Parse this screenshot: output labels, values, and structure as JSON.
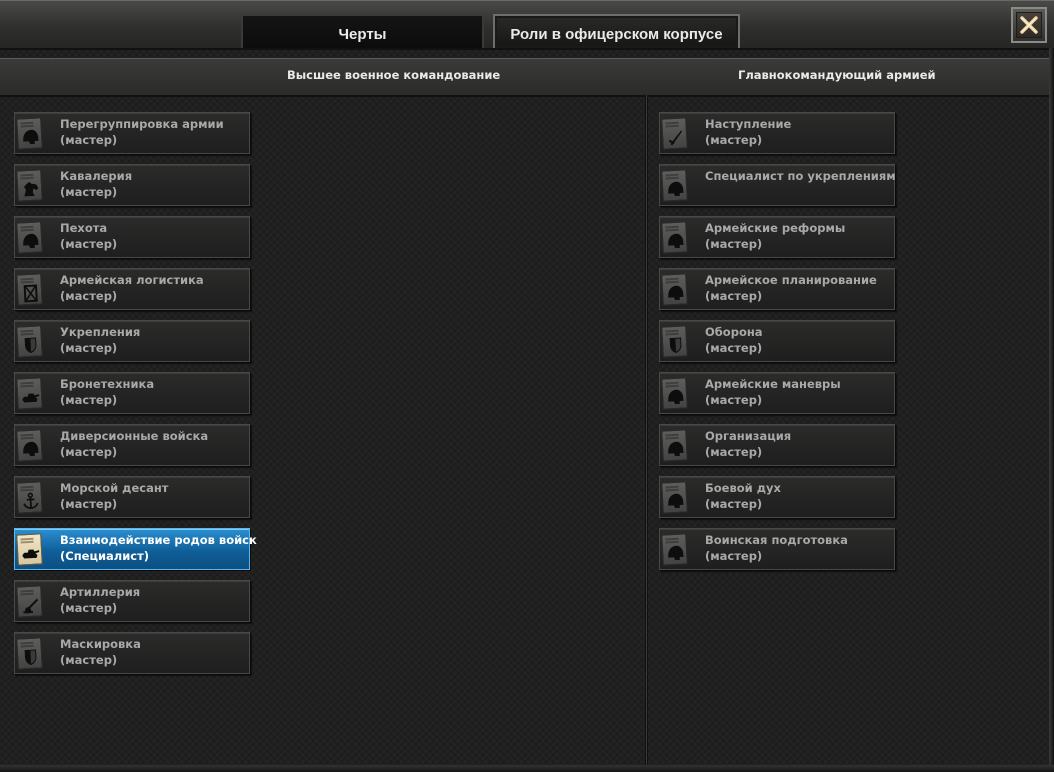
{
  "tabs": {
    "traits": "Черты",
    "roles": "Роли в офицерском корпусе"
  },
  "columns": {
    "left_title": "Высшее военное командование",
    "right_title": "Главнокомандующий армией"
  },
  "left_roles": [
    {
      "name": "Перегруппировка армии",
      "level": "(мастер)",
      "icon": "helmet-icon"
    },
    {
      "name": "Кавалерия",
      "level": "(мастер)",
      "icon": "horse-icon"
    },
    {
      "name": "Пехота",
      "level": "(мастер)",
      "icon": "helmet-icon"
    },
    {
      "name": "Армейская логистика",
      "level": "(мастер)",
      "icon": "supply-crate-icon"
    },
    {
      "name": "Укрепления",
      "level": "(мастер)",
      "icon": "shield-icon"
    },
    {
      "name": "Бронетехника",
      "level": "(мастер)",
      "icon": "tank-icon"
    },
    {
      "name": "Диверсионные войска",
      "level": "(мастер)",
      "icon": "helmet-icon"
    },
    {
      "name": "Морской десант",
      "level": "(мастер)",
      "icon": "anchor-icon"
    },
    {
      "name": "Взаимодействие родов войск",
      "level": "(Специалист)",
      "icon": "tank-icon",
      "selected": true
    },
    {
      "name": "Артиллерия",
      "level": "(мастер)",
      "icon": "artillery-icon"
    },
    {
      "name": "Маскировка",
      "level": "(мастер)",
      "icon": "shield-icon"
    }
  ],
  "right_roles": [
    {
      "name": "Наступление",
      "level": "(мастер)",
      "icon": "sword-icon"
    },
    {
      "name": "Специалист по укреплениям",
      "level": "",
      "icon": "helmet-icon"
    },
    {
      "name": "Армейские реформы",
      "level": "(мастер)",
      "icon": "helmet-icon"
    },
    {
      "name": "Армейское планирование",
      "level": "(мастер)",
      "icon": "helmet-icon"
    },
    {
      "name": "Оборона",
      "level": "(мастер)",
      "icon": "shield-icon"
    },
    {
      "name": "Армейские маневры",
      "level": "(мастер)",
      "icon": "helmet-icon"
    },
    {
      "name": "Организация",
      "level": "(мастер)",
      "icon": "helmet-icon"
    },
    {
      "name": "Боевой дух",
      "level": "(мастер)",
      "icon": "helmet-icon"
    },
    {
      "name": "Воинская подготовка",
      "level": "(мастер)",
      "icon": "helmet-icon"
    }
  ],
  "colors": {
    "selected_top": "#2c8fd1",
    "selected_bottom": "#0c4f82",
    "text_muted": "#a9a9a9",
    "text_bright": "#ffffff"
  }
}
